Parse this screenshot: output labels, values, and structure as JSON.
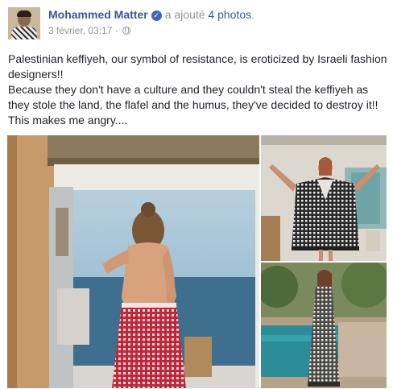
{
  "post": {
    "author": "Mohammed Matter",
    "action": "a ajouté",
    "photos_link": "4 photos",
    "punctuation": ".",
    "timestamp": "3 février, 03:17",
    "separator": "·",
    "privacy_icon": "globe-icon",
    "verified_icon": "verified-badge-icon",
    "text_lines": [
      "Palestinian keffiyeh, our symbol of resistance, is eroticized by Israeli fashion designers!!",
      "Because they don't have a culture and they couldn't steal the keffiyeh as they stole the land, the flafel and the humus, they've decided to destroy it!!",
      "This makes me angry...."
    ]
  },
  "colors": {
    "link": "#365899",
    "muted": "#90949c",
    "text": "#1d2129",
    "verified": "#4267b2",
    "keffiyeh_red": "#c0283a"
  }
}
